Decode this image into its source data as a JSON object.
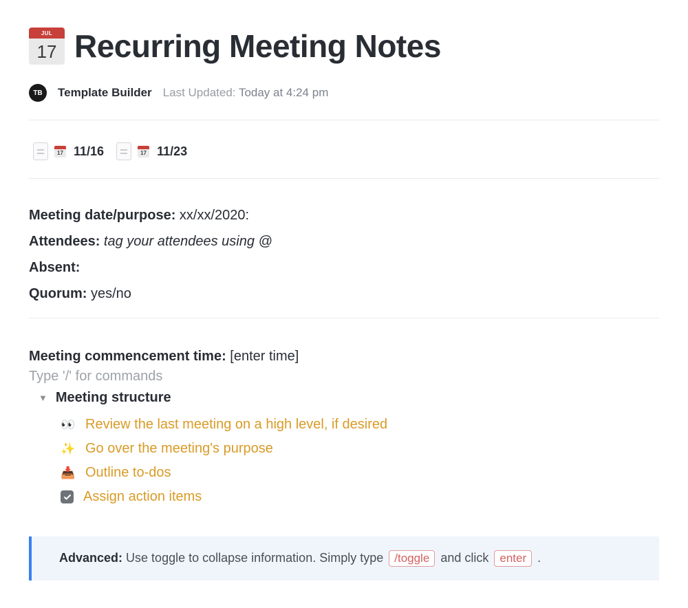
{
  "header": {
    "icon_month": "JUL",
    "icon_day": "17",
    "title": "Recurring Meeting Notes",
    "avatar_initials": "TB",
    "author": "Template Builder",
    "updated_label": "Last Updated:",
    "updated_value": "Today at 4:24 pm"
  },
  "links": [
    {
      "icon_day": "17",
      "label": "11/16"
    },
    {
      "icon_day": "17",
      "label": "11/23"
    }
  ],
  "fields": {
    "date_label": "Meeting date/purpose:",
    "date_value": "xx/xx/2020:",
    "attendees_label": "Attendees:",
    "attendees_value": "tag your attendees using @",
    "absent_label": "Absent:",
    "quorum_label": "Quorum:",
    "quorum_value": "yes/no"
  },
  "commence": {
    "label": "Meeting commencement time:",
    "value": "[enter time]"
  },
  "slash_hint": "Type '/' for commands",
  "structure": {
    "heading": "Meeting structure",
    "items": [
      {
        "emoji": "👀",
        "text": "Review the last meeting on a high level, if desired"
      },
      {
        "emoji": "✨",
        "text": "Go over the meeting's purpose"
      },
      {
        "emoji": "📥",
        "text": "Outline to-dos"
      },
      {
        "emoji": "check",
        "text": "Assign action items"
      }
    ]
  },
  "callout": {
    "strong": "Advanced:",
    "text1": "Use toggle to collapse information. Simply type",
    "kbd1": "/toggle",
    "text2": "and click",
    "kbd2": "enter",
    "text3": "."
  }
}
